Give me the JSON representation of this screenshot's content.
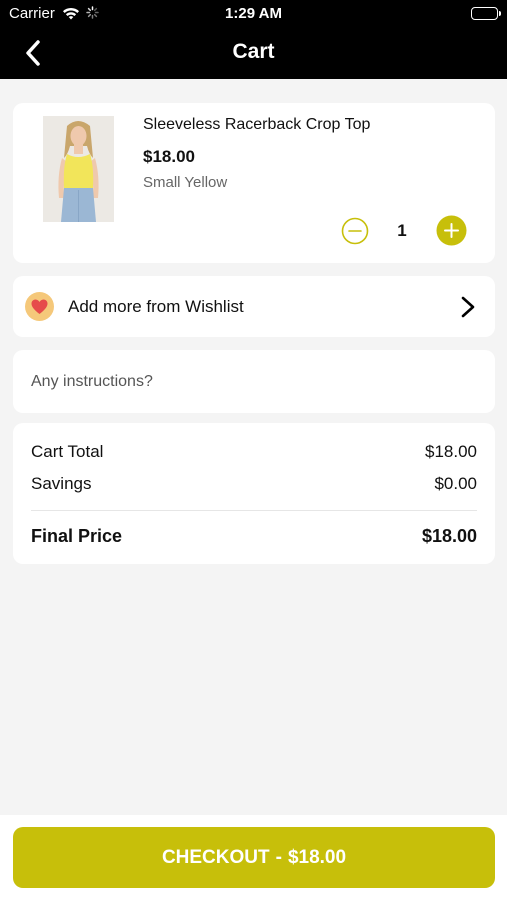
{
  "status_bar": {
    "carrier": "Carrier",
    "time": "1:29 AM"
  },
  "nav": {
    "title": "Cart",
    "back_icon": "chevron-left-icon"
  },
  "cart_item": {
    "name": "Sleeveless Racerback Crop Top",
    "price": "$18.00",
    "variant": "Small Yellow",
    "quantity": "1"
  },
  "wishlist": {
    "label": "Add more from Wishlist",
    "icon": "heart-icon",
    "chevron_icon": "chevron-right-icon"
  },
  "instructions": {
    "placeholder": "Any instructions?",
    "value": ""
  },
  "summary": {
    "cart_total_label": "Cart Total",
    "cart_total_value": "$18.00",
    "savings_label": "Savings",
    "savings_value": "$0.00",
    "final_price_label": "Final Price",
    "final_price_value": "$18.00"
  },
  "checkout": {
    "label": "CHECKOUT",
    "separator": "-",
    "amount": "$18.00"
  },
  "colors": {
    "accent": "#c7bf0a",
    "header_bg": "#000000",
    "page_bg": "#f4f4f4",
    "heart": "#e64b4b",
    "heart_badge": "#f5c87a"
  }
}
